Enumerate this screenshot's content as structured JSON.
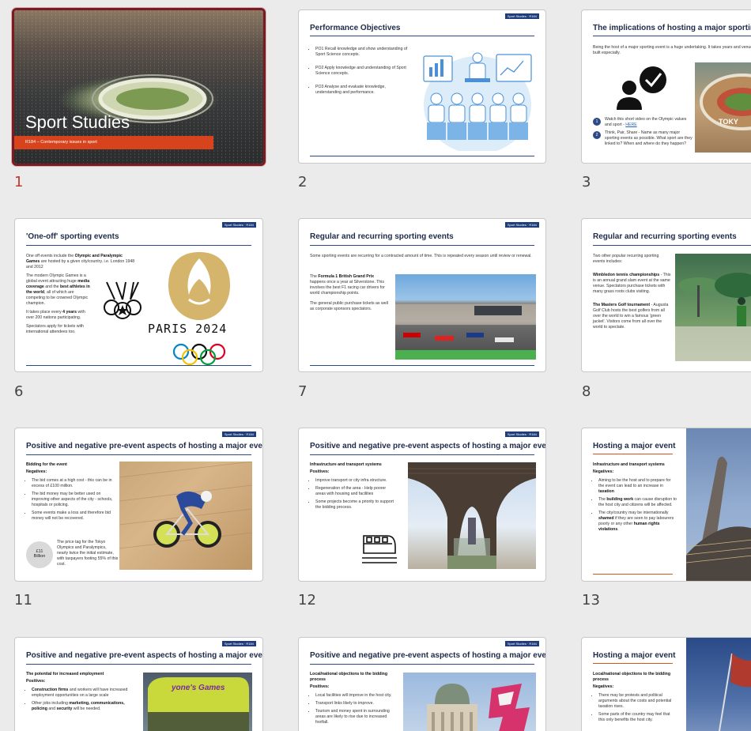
{
  "slides": [
    {
      "num": "1",
      "title": "Sport Studies",
      "subtitle": "R184 – Contemporary issues in sport"
    },
    {
      "num": "2",
      "title": "Performance Objectives",
      "tag": "Sport Studies · R184",
      "items": [
        "PO1 Recall knowledge and show understanding of Sport Science concepts.",
        "PO2 Apply knowledge and understanding of Sport Science concepts.",
        "PO3 Analyse and evaluate knowledge, understanding and performance."
      ]
    },
    {
      "num": "3",
      "title": "The implications of hosting a major sporting eve",
      "intro": "Being the host of a major sporting event is a huge undertaking. It takes years and venue are built especially.",
      "step1": "Watch this short video on the Olympic values and sport -",
      "link": "HERE",
      "step2": "Think, Pair, Share - Name as many major sporting events as possible. What sport are they linked to? When and where do they happen?",
      "badge1": "1",
      "badge2": "2",
      "stadium_text": "TOKY"
    },
    {
      "num": "6",
      "title": "'One-off' sporting events",
      "tag": "Sport Studies · R184",
      "p1_a": "One off events include the ",
      "p1_b": "Olympic and Paralympic Games",
      "p1_c": " are hosted by a given city/country. i.e. London 1948 and 2012",
      "p2_a": "The modern Olympic Games is a global event attracting huge ",
      "p2_b": "media coverage",
      "p2_c": " and the ",
      "p2_d": "best athletes in the world",
      "p2_e": ", all of which are competing to be crowned Olympic champion.",
      "p3_a": "It takes place every ",
      "p3_b": "4 years",
      "p3_c": " with over 200 nations participating.",
      "p4": "Spectators apply for tickets with international attendees too.",
      "logo_text": "PARIS 2024"
    },
    {
      "num": "7",
      "title": "Regular and recurring sporting events",
      "tag": "Sport Studies · R184",
      "intro": "Some sporting events are recurring for a contracted amount of time. This is repeated every season until review or renewal.",
      "p1_a": "The ",
      "p1_b": "Formula 1 British Grand Prix",
      "p1_c": " happens once a year at Silverstone. This involves the best F1 racing car drivers for world championship points.",
      "p2": "The general public purchase tickets as well as corporate sponsors spectators."
    },
    {
      "num": "8",
      "title": "Regular and recurring sporting events",
      "intro": "Two other popular recurring sporting events includes:",
      "p1_b": "Wimbledon tennis championships",
      "p1_c": " - This is an annual grand slam event at the same venue. Spectators purchase tickets with many grass roots clubs visiting.",
      "p2_b": "The Masters Golf tournament",
      "p2_c": " - Augusta Golf Club hosts the best golfers from all over the world to win a famous 'green jacket'. Visitors come from all over the world to spectate."
    },
    {
      "num": "11",
      "title": "Positive and negative pre-event aspects of hosting a major event",
      "tag": "Sport Studies · R184",
      "heading": "Bidding for the event",
      "sub": "Negatives:",
      "items": [
        "The bid comes at a high cost - this can be in excess of £100 million.",
        "The bid money may be better used on improving other aspects of the city - schools, hospitals or policing.",
        "Some events make a loss and therefore bid money will not be recovered."
      ],
      "circle_top": "£11",
      "circle_bottom": "Billion",
      "note": "The price tag for the Tokyo Olympics and Paralympics, nearly twice the initial estimate, with taxpayers footing 55% of this cost."
    },
    {
      "num": "12",
      "title": "Positive and negative pre-event aspects of hosting a major event",
      "tag": "Sport Studies · R184",
      "heading": "Infrastructure and transport systems",
      "sub": "Positives:",
      "items": [
        "Improve transport or city infra structure.",
        "Regeneration of the area - Help poorer areas with housing and facilities",
        "Some projects become a priority to support the bidding process."
      ]
    },
    {
      "num": "13",
      "title": "Hosting a major event",
      "heading": "Infrastructure and transport systems",
      "sub": "Negatives:",
      "i1_a": "Aiming to be the host and to prepare for the event can lead to an increase in ",
      "i1_b": "taxation",
      "i2_a": "The ",
      "i2_b": "building work",
      "i2_c": " can cause disruption to the host city and citizens will be affected.",
      "i3_a": "The city/country may be internationally ",
      "i3_b": "shamed",
      "i3_c": " if they are seen to pay labourers poorly or any other ",
      "i3_d": "human rights violations",
      "i3_e": "."
    },
    {
      "num": "",
      "title": "Positive and negative pre-event aspects of hosting a major event",
      "tag": "Sport Studies · R184",
      "heading": "The potential for increased employment",
      "sub": "Positives:",
      "i1_b": "Construction firms",
      "i1_c": " and workers will have increased employment opportunities on a large scale",
      "i2_a": "Other jobs including ",
      "i2_b": "marketing, communications, policing",
      "i2_c": " and ",
      "i2_d": "security",
      "i2_e": " will be needed.",
      "bus_text": "yone's Games"
    },
    {
      "num": "",
      "title": "Positive and negative pre-event aspects of hosting a major event",
      "tag": "Sport Studies · R184",
      "heading": "Local/national objections to the bidding process",
      "sub": "Positives:",
      "items": [
        "Local facilities will improve in the host city.",
        "Transport links likely to improve.",
        "Tourism and money spent in surrounding areas are likely to rise due to increased footfall."
      ]
    },
    {
      "num": "",
      "title": "Hosting a major event",
      "heading": "Local/national objections to the bidding process",
      "sub": "Negatives:",
      "items": [
        "There may be protests and political arguments about the costs and potential taxation rises.",
        "Some parts of the country may feel that this only benefits the host city."
      ]
    }
  ]
}
